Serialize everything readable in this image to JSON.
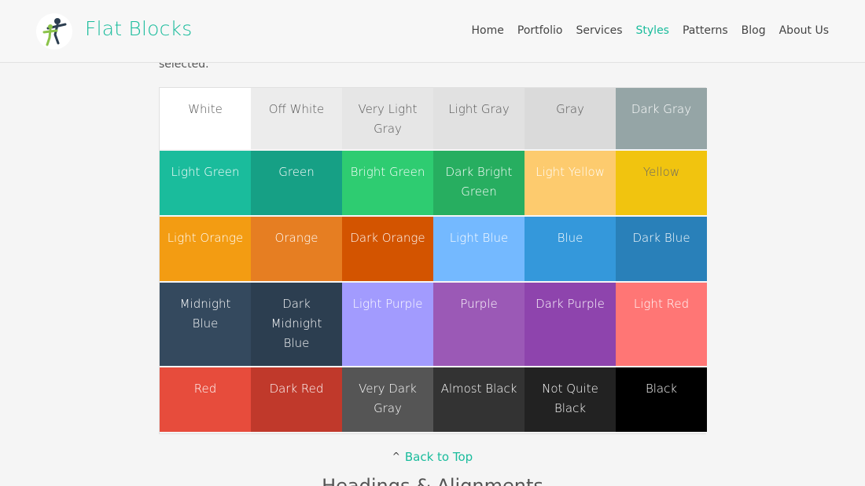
{
  "header": {
    "site_title": "Flat Blocks",
    "nav": [
      {
        "label": "Home",
        "active": false
      },
      {
        "label": "Portfolio",
        "active": false
      },
      {
        "label": "Services",
        "active": false
      },
      {
        "label": "Styles",
        "active": true
      },
      {
        "label": "Patterns",
        "active": false
      },
      {
        "label": "Blog",
        "active": false
      },
      {
        "label": "About Us",
        "active": false
      }
    ],
    "accent_color": "#1abc9c"
  },
  "intro_text": "selected.",
  "swatches": [
    {
      "name": "White",
      "color": "#ffffff",
      "text": "dark"
    },
    {
      "name": "Off White",
      "color": "#ececec",
      "text": "dark"
    },
    {
      "name": "Very Light Gray",
      "color": "#e6e6e6",
      "text": "dark"
    },
    {
      "name": "Light Gray",
      "color": "#e1e1e1",
      "text": "dark"
    },
    {
      "name": "Gray",
      "color": "#dadada",
      "text": "dark"
    },
    {
      "name": "Dark Gray",
      "color": "#95a5a6",
      "text": "light"
    },
    {
      "name": "Light Green",
      "color": "#1abc9c",
      "text": "light"
    },
    {
      "name": "Green",
      "color": "#16a085",
      "text": "light"
    },
    {
      "name": "Bright Green",
      "color": "#2ecc71",
      "text": "light"
    },
    {
      "name": "Dark Bright Green",
      "color": "#27ae60",
      "text": "light"
    },
    {
      "name": "Light Yellow",
      "color": "#fdcb6e",
      "text": "light"
    },
    {
      "name": "Yellow",
      "color": "#f1c40f",
      "text": "mid"
    },
    {
      "name": "Light Orange",
      "color": "#f39c12",
      "text": "light"
    },
    {
      "name": "Orange",
      "color": "#e67e22",
      "text": "light"
    },
    {
      "name": "Dark Orange",
      "color": "#d35400",
      "text": "light"
    },
    {
      "name": "Light Blue",
      "color": "#74b9ff",
      "text": "light"
    },
    {
      "name": "Blue",
      "color": "#3498db",
      "text": "light"
    },
    {
      "name": "Dark Blue",
      "color": "#2980b9",
      "text": "light"
    },
    {
      "name": "Midnight Blue",
      "color": "#34495e",
      "text": "light"
    },
    {
      "name": "Dark Midnight Blue",
      "color": "#2c3e50",
      "text": "light"
    },
    {
      "name": "Light Purple",
      "color": "#a29bfe",
      "text": "light"
    },
    {
      "name": "Purple",
      "color": "#9b59b6",
      "text": "light"
    },
    {
      "name": "Dark Purple",
      "color": "#8e44ad",
      "text": "light"
    },
    {
      "name": "Light Red",
      "color": "#ff7675",
      "text": "light"
    },
    {
      "name": "Red",
      "color": "#e74c3c",
      "text": "light"
    },
    {
      "name": "Dark Red",
      "color": "#c0392b",
      "text": "light"
    },
    {
      "name": "Very Dark Gray",
      "color": "#555555",
      "text": "light"
    },
    {
      "name": "Almost Black",
      "color": "#333333",
      "text": "light"
    },
    {
      "name": "Not Quite Black",
      "color": "#222222",
      "text": "light"
    },
    {
      "name": "Black",
      "color": "#000000",
      "text": "light"
    }
  ],
  "back_to_top": "Back to Top",
  "next_section_heading": "Headings & Alignments"
}
